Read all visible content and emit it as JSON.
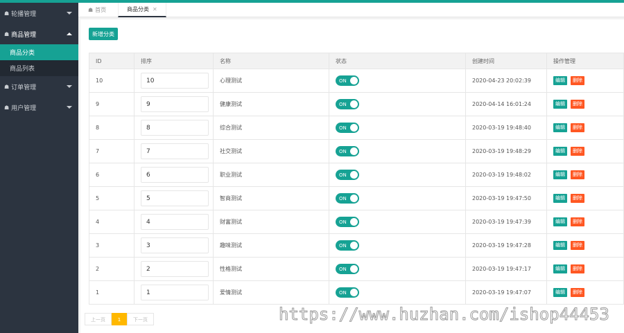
{
  "sidebar": {
    "menu1": {
      "label": "轮播管理"
    },
    "menu2": {
      "label": "商品管理"
    },
    "sub1": {
      "label": "商品分类"
    },
    "sub2": {
      "label": "商品列表"
    },
    "menu3": {
      "label": "订单管理"
    },
    "menu4": {
      "label": "用户管理"
    }
  },
  "tabs": {
    "home": "首页",
    "current": "商品分类"
  },
  "toolbar": {
    "add_label": "新增分类"
  },
  "table": {
    "headers": [
      "ID",
      "排序",
      "名称",
      "状态",
      "创建时间",
      "操作管理"
    ],
    "switch_label": "ON",
    "edit_label": "编辑",
    "delete_label": "删除",
    "rows": [
      {
        "id": "10",
        "sort": "10",
        "name": "心理测试",
        "time": "2020-04-23 20:02:39"
      },
      {
        "id": "9",
        "sort": "9",
        "name": "健康测试",
        "time": "2020-04-14 16:01:24"
      },
      {
        "id": "8",
        "sort": "8",
        "name": "综合测试",
        "time": "2020-03-19 19:48:40"
      },
      {
        "id": "7",
        "sort": "7",
        "name": "社交测试",
        "time": "2020-03-19 19:48:29"
      },
      {
        "id": "6",
        "sort": "6",
        "name": "职业测试",
        "time": "2020-03-19 19:48:02"
      },
      {
        "id": "5",
        "sort": "5",
        "name": "智商测试",
        "time": "2020-03-19 19:47:50"
      },
      {
        "id": "4",
        "sort": "4",
        "name": "财富测试",
        "time": "2020-03-19 19:47:39"
      },
      {
        "id": "3",
        "sort": "3",
        "name": "趣味测试",
        "time": "2020-03-19 19:47:28"
      },
      {
        "id": "2",
        "sort": "2",
        "name": "性格测试",
        "time": "2020-03-19 19:47:17"
      },
      {
        "id": "1",
        "sort": "1",
        "name": "爱情测试",
        "time": "2020-03-19 19:47:07"
      }
    ]
  },
  "pager": {
    "prev": "上一页",
    "current": "1",
    "next": "下一页"
  },
  "watermark": "https://www.huzhan.com/ishop44453",
  "colors": {
    "accent": "#16a294",
    "danger": "#ff5722",
    "pager_current": "#ffb800",
    "sidebar": "#2c3440"
  }
}
